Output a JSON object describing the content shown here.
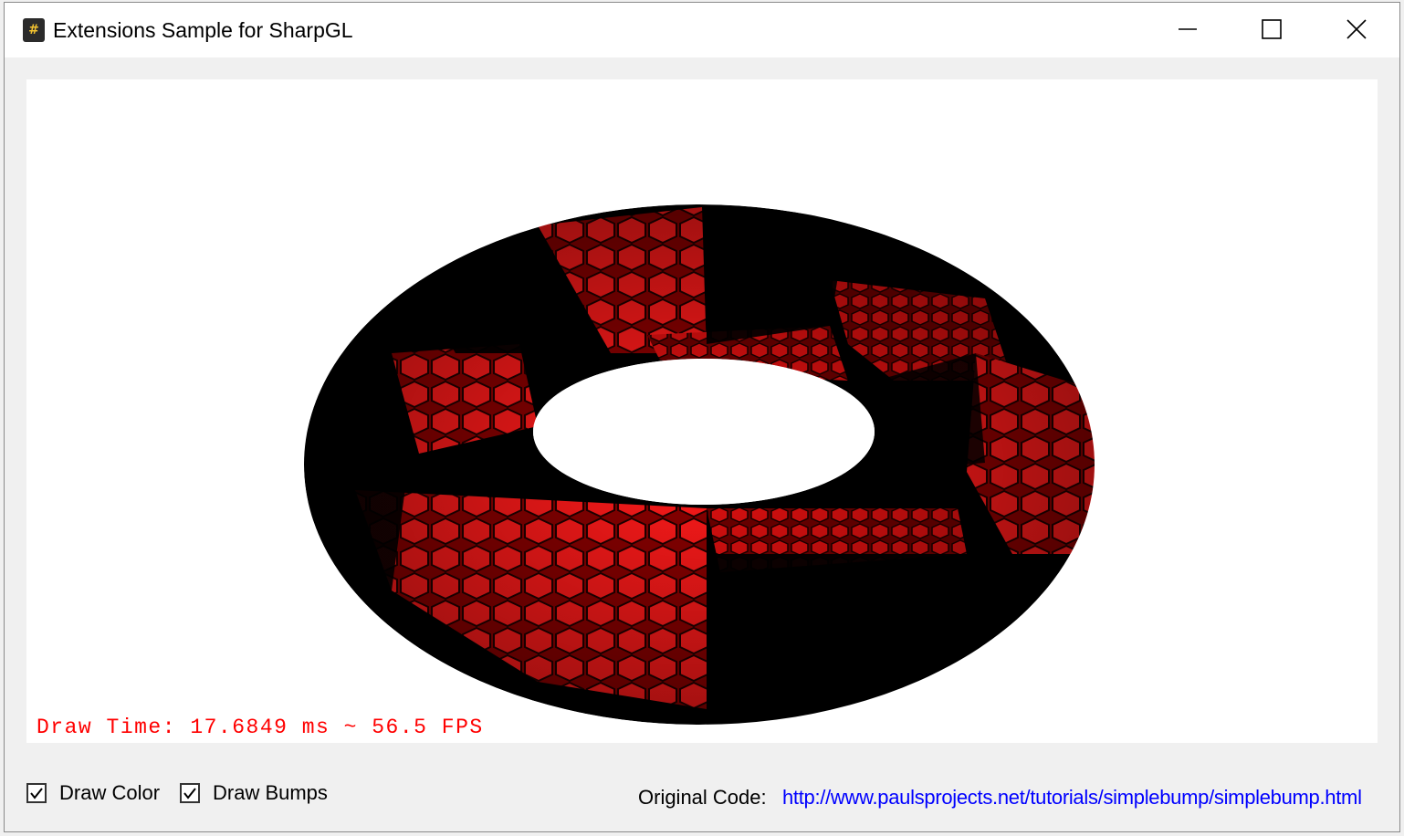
{
  "window": {
    "title": "Extensions Sample for SharpGL",
    "app_icon": "sharpgl-app-icon"
  },
  "caption_buttons": {
    "minimize_icon": "minimize-icon",
    "maximize_icon": "maximize-icon",
    "close_icon": "close-icon"
  },
  "viewport": {
    "draw_time_text": "Draw Time: 17.6849 ms ~ 56.5 FPS",
    "draw_time_color": "#ff0000",
    "scene": "bump-mapped red torus"
  },
  "options": {
    "draw_color_label": "Draw Color",
    "draw_color_checked": true,
    "draw_bumps_label": "Draw Bumps",
    "draw_bumps_checked": true
  },
  "footer": {
    "original_code_label": "Original Code:",
    "original_code_link": "http://www.paulsprojects.net/tutorials/simplebump/simplebump.html",
    "link_color": "#0000ff"
  }
}
